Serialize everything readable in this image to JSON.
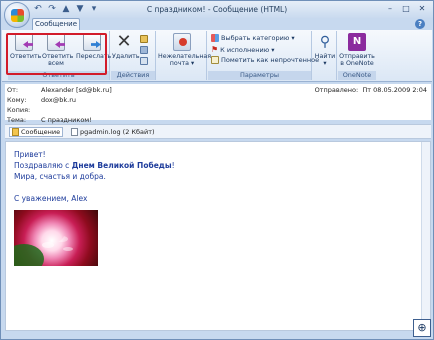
{
  "window": {
    "title": "С праздником! - Сообщение (HTML)"
  },
  "ribbon": {
    "tab": "Сообщение",
    "groups": {
      "respond": {
        "label": "Ответить",
        "reply": "Ответить",
        "reply_all_1": "Ответить",
        "reply_all_2": "всем",
        "forward": "Переслать"
      },
      "actions": {
        "label": "Действия",
        "delete": "Удалить"
      },
      "junk": {
        "label_1": "Нежелательная",
        "label_2": "почта"
      },
      "options": {
        "label": "Параметры",
        "category": "Выбрать категорию",
        "followup": "К исполнению",
        "mark_unread": "Пометить как непрочтенное"
      },
      "find": {
        "label": "Найти"
      },
      "onenote": {
        "label": "OneNote",
        "send_1": "Отправить",
        "send_2": "в OneNote"
      }
    }
  },
  "headers": {
    "from_label": "От:",
    "from_value": "Alexander [sd@bk.ru]",
    "to_label": "Кому:",
    "to_value": "dox@bk.ru",
    "cc_label": "Копия:",
    "subject_label": "Тема:",
    "subject_value": "С праздником!",
    "sent_label": "Отправлено:",
    "sent_value": "Пт 08.05.2009 2:04"
  },
  "attachments": [
    {
      "name": "Сообщение"
    },
    {
      "name": "pgadmin.log (2 Кбайт)"
    }
  ],
  "message": {
    "line1": "Привет!",
    "line2_pre": "Поздравляю с ",
    "line2_bold": "Днем Великой Победы",
    "line2_post": "!",
    "line3": "Мира, счастья и добра.",
    "line4": "С уважением, Alex"
  },
  "icons": {
    "office": "office-logo-icon",
    "zoom": "zoom-icon"
  }
}
